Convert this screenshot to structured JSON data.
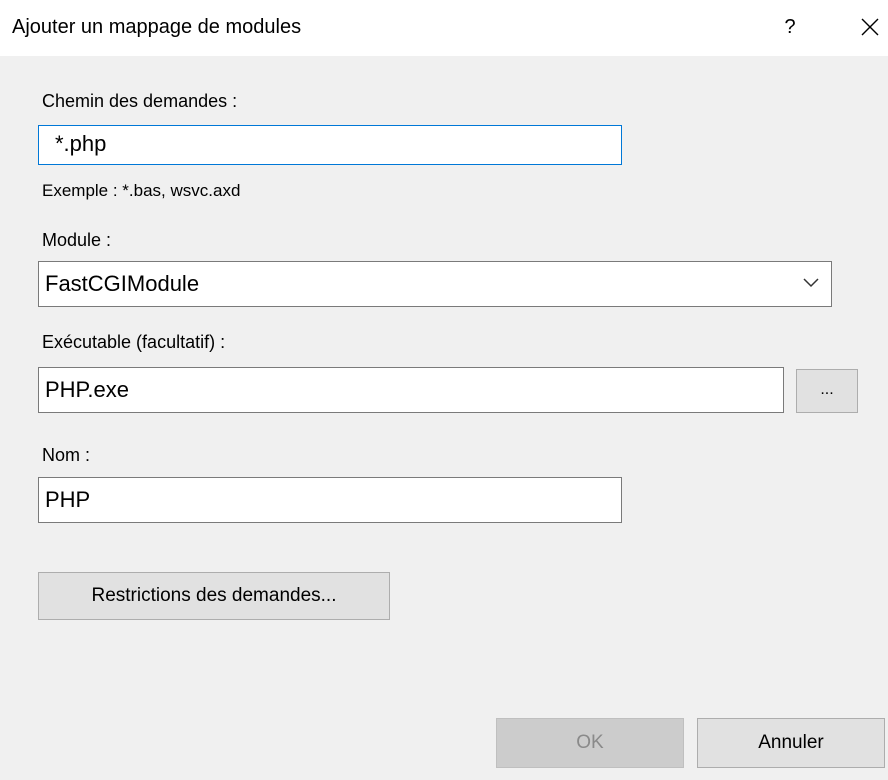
{
  "window": {
    "title": "Ajouter un mappage de modules",
    "help_label": "?"
  },
  "request_path": {
    "label": "Chemin des demandes :",
    "value": "*.php",
    "example": "Exemple : *.bas, wsvc.axd"
  },
  "module": {
    "label": "Module :",
    "selected": "FastCGIModule"
  },
  "executable": {
    "label": "Exécutable (facultatif) :",
    "value": "PHP.exe",
    "browse_label": "..."
  },
  "name": {
    "label": "Nom :",
    "value": "PHP"
  },
  "buttons": {
    "restrictions": "Restrictions des demandes...",
    "ok": "OK",
    "cancel": "Annuler"
  },
  "colors": {
    "focus_border": "#0078d7",
    "dialog_bg": "#f0f0f0",
    "titlebar_bg": "#ffffff"
  }
}
